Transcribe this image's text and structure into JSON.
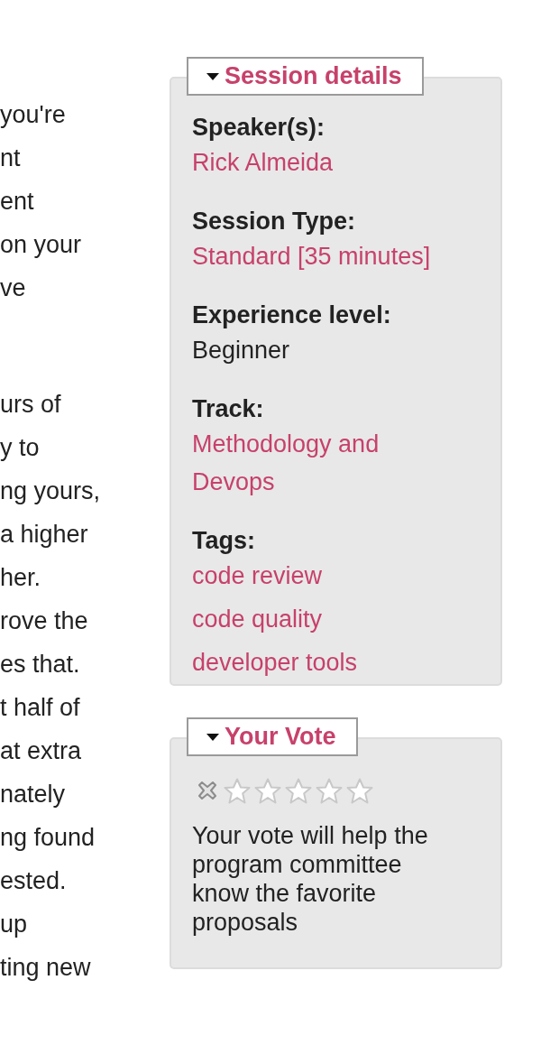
{
  "body_text": {
    "paragraphs": [
      {
        "lines": [
          "you're",
          "nt",
          "ent",
          "on your",
          "ve"
        ]
      },
      {
        "lines": [
          "urs of",
          "y to",
          "ng yours,",
          "a higher",
          "her.",
          "rove the",
          "es that.",
          "t half of",
          "at extra",
          "nately",
          "ng found",
          "ested.",
          "up",
          "ting new"
        ]
      }
    ]
  },
  "session_details": {
    "title": "Session details",
    "expanded": true,
    "fields": [
      {
        "label": "Speaker(s):",
        "values": [
          {
            "kind": "link",
            "text": "Rick Almeida"
          }
        ]
      },
      {
        "label": "Session Type:",
        "values": [
          {
            "kind": "link",
            "text": "Standard [35 minutes]"
          }
        ]
      },
      {
        "label": "Experience level:",
        "values": [
          {
            "kind": "text",
            "text": "Beginner"
          }
        ]
      },
      {
        "label": "Track:",
        "values": [
          {
            "kind": "link",
            "text": "Methodology and Devops"
          }
        ]
      },
      {
        "label": "Tags:",
        "values": [
          {
            "kind": "link",
            "text": "code review"
          },
          {
            "kind": "link",
            "text": "code quality"
          },
          {
            "kind": "link",
            "text": "developer tools"
          }
        ]
      }
    ]
  },
  "vote": {
    "title": "Your Vote",
    "expanded": true,
    "stars": 0,
    "description": "Your vote will help the program committee know the favorite proposals"
  }
}
